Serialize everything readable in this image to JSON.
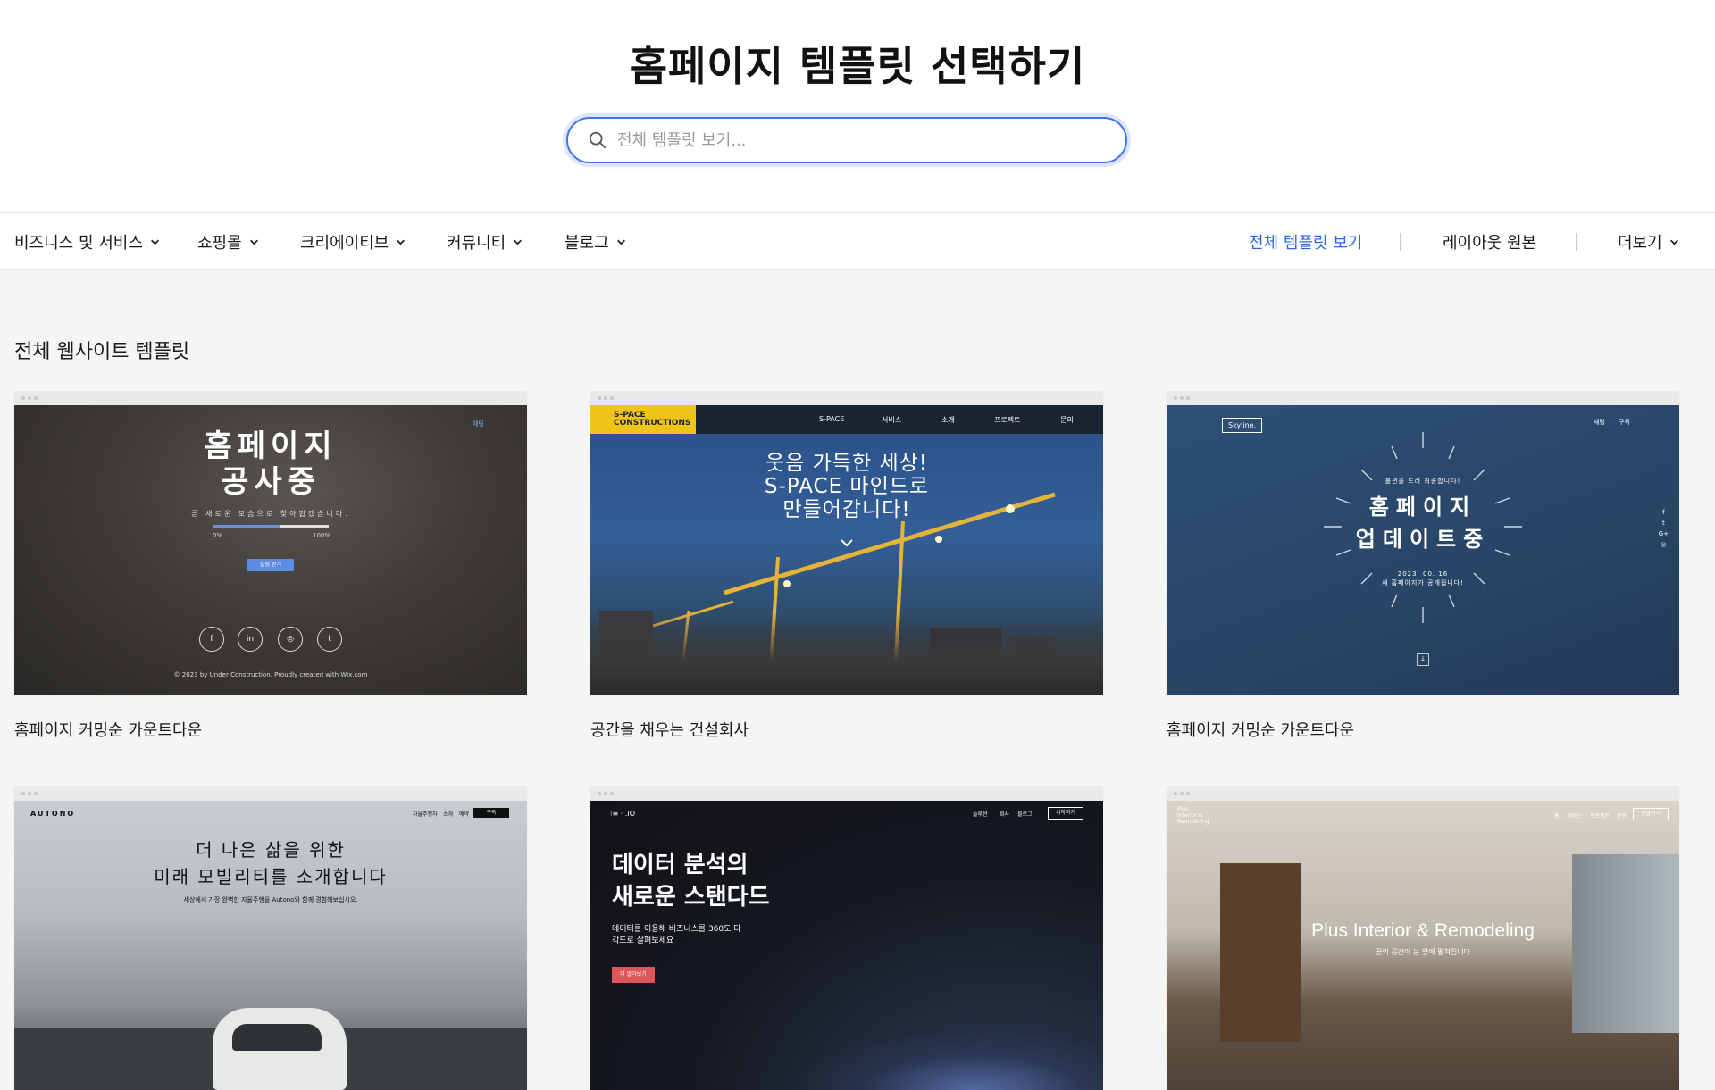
{
  "header": {
    "title": "홈페이지 템플릿 선택하기",
    "search_placeholder": "전체 템플릿 보기..."
  },
  "nav": {
    "categories": [
      "비즈니스 및 서비스",
      "쇼핑몰",
      "크리에이티브",
      "커뮤니티",
      "블로그"
    ],
    "right": {
      "all_templates": "전체 템플릿 보기",
      "layout_original": "레이아웃 원본",
      "more": "더보기"
    }
  },
  "section": {
    "title": "전체 웹사이트 템플릿"
  },
  "cards": [
    {
      "label": "홈페이지 커밍순 카운트다운",
      "preview": {
        "heading_1": "홈페이지",
        "heading_2": "공사중",
        "subtitle": "곧 새로운 모습으로 찾아뵙겠습니다.",
        "progress": 0.58,
        "progress_start": "0%",
        "progress_end": "100%",
        "button": "알림 받기",
        "social": [
          "f",
          "in",
          "◎",
          "t"
        ],
        "copyright": "© 2023 by Under Construction. Proudly created with Wix.com",
        "corner": "채팅"
      }
    },
    {
      "label": "공간을 채우는 건설회사",
      "preview": {
        "logo_1": "S-PACE",
        "logo_2": "CONSTRUCTIONS",
        "menu": [
          "S-PACE",
          "서비스",
          "소개",
          "프로젝트",
          "문의"
        ],
        "heading_1": "웃음 가득한 세상!",
        "heading_2": "S-PACE 마인드로",
        "heading_3": "만들어갑니다!"
      }
    },
    {
      "label": "홈페이지 커밍순 카운트다운",
      "preview": {
        "logo": "Skyline.",
        "menu": [
          "채팅",
          "구독"
        ],
        "small": "불편을 드려 죄송합니다!",
        "heading_1": "홈페이지",
        "heading_2": "업데이트중",
        "date": "2023. 00. 16",
        "date_sub": "새 홈페이지가 공개됩니다!",
        "side": [
          "f",
          "t",
          "G+",
          "◎"
        ]
      }
    },
    {
      "label": "",
      "preview": {
        "logo": "AUTONO",
        "menu": [
          "자율주행차",
          "소개",
          "예약"
        ],
        "cta": "구독",
        "heading_1": "더 나은 삶을 위한",
        "heading_2": "미래 모빌리티를 소개합니다",
        "subtitle": "세상에서 가장 완벽한 자율주행을 Autono와 함께 경험해보십시오."
      }
    },
    {
      "label": "",
      "preview": {
        "logo": "⁝≡ · .IO",
        "menu": [
          "솔루션",
          "회사",
          "블로그"
        ],
        "cta": "시작하기",
        "heading_1": "데이터 분석의",
        "heading_2": "새로운 스탠다드",
        "sub_1": "데이터를 이용해 비즈니스를 360도 다",
        "sub_2": "각도로 살펴보세요",
        "button": "더 알아보기"
      }
    },
    {
      "label": "",
      "preview": {
        "logo_1": "Plus",
        "logo_2": "Interior &",
        "logo_3": "Remodeling",
        "menu": [
          "홈",
          "서비스",
          "프로젝트",
          "문의"
        ],
        "cta": "상담하기",
        "heading": "Plus Interior & Remodeling",
        "subtitle": "꿈의 공간이 눈 앞에 펼쳐집니다"
      }
    }
  ]
}
